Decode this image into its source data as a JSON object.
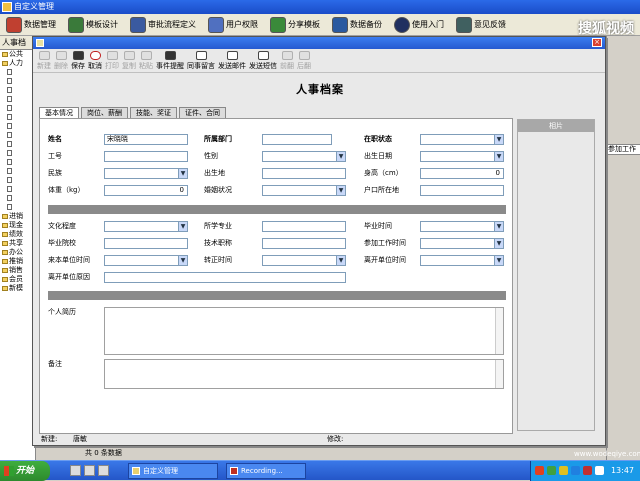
{
  "app": {
    "title": "自定义管理",
    "watermark": "搜狐视频"
  },
  "mainbar": {
    "items": [
      {
        "label": "数据管理",
        "color": "#c04030"
      },
      {
        "label": "模板设计",
        "color": "#3a7a3a"
      },
      {
        "label": "审批流程定义",
        "color": "#3a5aa0"
      },
      {
        "label": "用户权限",
        "color": "#5070c0"
      },
      {
        "label": "分享模板",
        "color": "#3a8a3a"
      },
      {
        "label": "数据备份",
        "color": "#2a5aa0"
      },
      {
        "label": "使用入门",
        "color": "#203060"
      },
      {
        "label": "意见反馈",
        "color": "#406060"
      }
    ]
  },
  "leftpanel": {
    "tab": "人事档",
    "items": [
      "公共",
      "人力",
      "",
      "",
      "",
      "",
      "",
      "",
      "",
      "",
      "",
      "",
      "",
      "",
      "",
      "",
      "",
      "",
      "进销",
      "现金",
      "绩效",
      "共享",
      "办公",
      "推销",
      "销售",
      "会员",
      "新模"
    ]
  },
  "rightpanel": {
    "text": "参加工作"
  },
  "toolbar": {
    "buttons": [
      {
        "label": "新建",
        "icon": "new-icon",
        "enabled": false
      },
      {
        "label": "删除",
        "icon": "delete-icon",
        "enabled": false
      },
      {
        "label": "保存",
        "icon": "save-icon",
        "enabled": true
      },
      {
        "label": "取消",
        "icon": "cancel-icon",
        "enabled": true
      },
      {
        "label": "打印",
        "icon": "print-icon",
        "enabled": false
      },
      {
        "label": "复制",
        "icon": "copy-icon",
        "enabled": false
      },
      {
        "label": "粘贴",
        "icon": "paste-icon",
        "enabled": false
      },
      {
        "label": "事件提醒",
        "icon": "bell-icon",
        "enabled": true
      },
      {
        "label": "同事留言",
        "icon": "message-icon",
        "enabled": true
      },
      {
        "label": "发送邮件",
        "icon": "mail-icon",
        "enabled": true
      },
      {
        "label": "发送短信",
        "icon": "sms-icon",
        "enabled": true
      },
      {
        "label": "前翻",
        "icon": "prev-icon",
        "enabled": false
      },
      {
        "label": "后翻",
        "icon": "next-icon",
        "enabled": false
      }
    ]
  },
  "form": {
    "title": "人事档案",
    "tabs": [
      "基本情况",
      "岗位、薪酬",
      "技能、奖证",
      "证件、合同"
    ],
    "labels": {
      "name": "姓名",
      "dept": "所属部门",
      "status": "在职状态",
      "emp_no": "工号",
      "gender": "性别",
      "birth_date": "出生日期",
      "ethnicity": "民族",
      "birthplace": "出生地",
      "height": "身高（cm）",
      "weight": "体重（kg）",
      "marital": "婚姻状况",
      "hukou": "户口所在地",
      "education": "文化程度",
      "major": "所学专业",
      "grad_time": "毕业时间",
      "school": "毕业院校",
      "title": "技术职称",
      "work_start": "参加工作时间",
      "join_time": "来本单位时间",
      "regular_time": "转正时间",
      "leave_time": "离开单位时间",
      "leave_reason": "离开单位原因",
      "resume": "个人简历",
      "remarks": "备注"
    },
    "values": {
      "name": "宋晓晓",
      "height": "0",
      "weight": "0"
    },
    "photo_label": "相片",
    "dots_label": "..."
  },
  "status": {
    "created_label": "新建:",
    "created_by": "唐敏",
    "modified_label": "修改:"
  },
  "below": {
    "count_text": "共 0 条数据"
  },
  "website": "www.wodeqiye.com",
  "taskbar": {
    "start": "开始",
    "tasks": [
      "自定义管理",
      "Recording..."
    ],
    "clock": "13:47"
  }
}
